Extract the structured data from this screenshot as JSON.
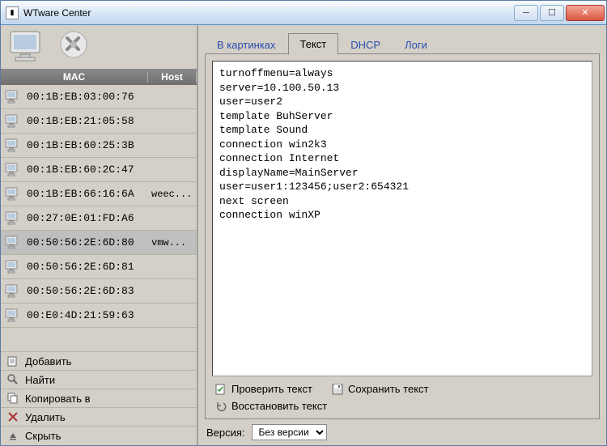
{
  "window": {
    "title": "WTware Center"
  },
  "list_header": {
    "mac": "MAC",
    "host": "Host"
  },
  "clients": [
    {
      "mac": "00:1B:EB:03:00:76",
      "host": "",
      "selected": false
    },
    {
      "mac": "00:1B:EB:21:05:58",
      "host": "",
      "selected": false
    },
    {
      "mac": "00:1B:EB:60:25:3B",
      "host": "",
      "selected": false
    },
    {
      "mac": "00:1B:EB:60:2C:47",
      "host": "",
      "selected": false
    },
    {
      "mac": "00:1B:EB:66:16:6A",
      "host": "weec...",
      "selected": false
    },
    {
      "mac": "00:27:0E:01:FD:A6",
      "host": "",
      "selected": false
    },
    {
      "mac": "00:50:56:2E:6D:80",
      "host": "vmw...",
      "selected": true
    },
    {
      "mac": "00:50:56:2E:6D:81",
      "host": "",
      "selected": false
    },
    {
      "mac": "00:50:56:2E:6D:83",
      "host": "",
      "selected": false
    },
    {
      "mac": "00:E0:4D:21:59:63",
      "host": "",
      "selected": false
    }
  ],
  "actions": {
    "add": "Добавить",
    "find": "Найти",
    "copy_to": "Копировать в",
    "delete": "Удалить",
    "hide": "Скрыть"
  },
  "tabs": {
    "pictures": "В картинках",
    "text": "Текст",
    "dhcp": "DHCP",
    "logs": "Логи",
    "active": "text"
  },
  "config_text": "turnoffmenu=always\nserver=10.100.50.13\nuser=user2\ntemplate BuhServer\ntemplate Sound\nconnection win2k3\nconnection Internet\ndisplayName=MainServer\nuser=user1:123456;user2:654321\nnext screen\nconnection winXP",
  "text_actions": {
    "check": "Проверить текст",
    "save": "Сохранить текст",
    "restore": "Восстановить текст"
  },
  "version": {
    "label": "Версия:",
    "value": "Без версии"
  }
}
